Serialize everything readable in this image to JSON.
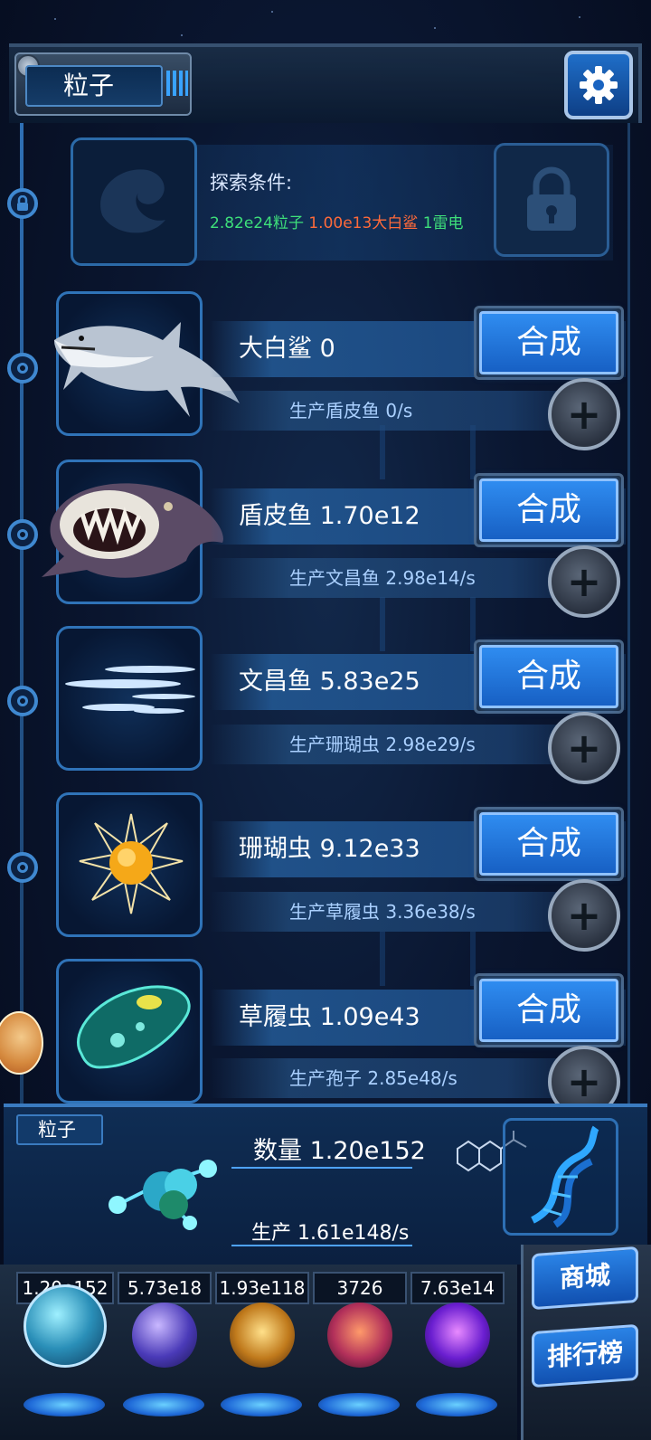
{
  "header": {
    "title": "粒子"
  },
  "locked_entry": {
    "explore_label": "探索条件:",
    "requirements": [
      {
        "text": "2.82e24粒子",
        "color": "#3ee07a"
      },
      {
        "text": "1.00e13大白鲨",
        "color": "#ff6a3a"
      },
      {
        "text": "1雷电",
        "color": "#3ee07a"
      }
    ]
  },
  "creatures": [
    {
      "name": "大白鲨 0",
      "production": "生产盾皮鱼 0/s",
      "synth_label": "合成",
      "icon": "shark-icon"
    },
    {
      "name": "盾皮鱼 1.70e12",
      "production": "生产文昌鱼 2.98e14/s",
      "synth_label": "合成",
      "icon": "dunkleosteus-icon"
    },
    {
      "name": "文昌鱼 5.83e25",
      "production": "生产珊瑚虫 2.98e29/s",
      "synth_label": "合成",
      "icon": "lancelet-icon"
    },
    {
      "name": "珊瑚虫 9.12e33",
      "production": "生产草履虫 3.36e38/s",
      "synth_label": "合成",
      "icon": "coral-polyp-icon"
    },
    {
      "name": "草履虫 1.09e43",
      "production": "生产孢子 2.85e48/s",
      "synth_label": "合成",
      "icon": "paramecium-icon"
    }
  ],
  "particle_panel": {
    "tag": "粒子",
    "count": "数量 1.20e152",
    "production": "生产 1.61e148/s"
  },
  "resources": [
    {
      "value": "1.20e152",
      "icon": "particle-orb-icon"
    },
    {
      "value": "5.73e18",
      "icon": "lightning-orb-icon"
    },
    {
      "value": "1.93e118",
      "icon": "fire-orb-icon"
    },
    {
      "value": "3726",
      "icon": "brain-orb-icon"
    },
    {
      "value": "7.63e14",
      "icon": "vortex-orb-icon"
    }
  ],
  "side_buttons": {
    "shop": "商城",
    "leaderboard": "排行榜"
  }
}
